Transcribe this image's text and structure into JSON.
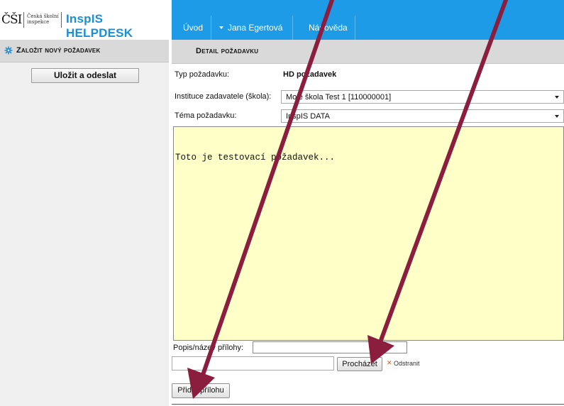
{
  "header": {
    "logo_mark": "ČŠI",
    "logo_org_line1": "Česká školní",
    "logo_org_line2": "inspekce",
    "brand": "InspIS HELPDESK",
    "nav": [
      {
        "label": "Úvod"
      },
      {
        "label": "Jana Egertová",
        "has_dropdown": true
      },
      {
        "label": "Nápověda"
      }
    ]
  },
  "sidebar": {
    "title": "Založit nový požadavek",
    "icon": "gear-icon",
    "save_button": "Uložit a odeslat"
  },
  "main": {
    "title": "Detail požadavku",
    "fields": {
      "type_label": "Typ požadavku:",
      "type_value": "HD požadavek",
      "institution_label": "Instituce zadavatele (škola):",
      "institution_value": "Moje škola Test 1 [110000001]",
      "topic_label": "Téma požadavku:",
      "topic_value": "InspIS DATA"
    },
    "message_text": "Toto je testovací požadavek...",
    "attachment": {
      "label": "Popis/název přílohy:",
      "description_value": "",
      "browse_button": "Procházet",
      "remove_label": "Odstranit",
      "add_button": "Přidat přílohu"
    }
  },
  "colors": {
    "nav_bg": "#1e9be6",
    "brand": "#1b8fd3",
    "textarea_bg": "#ffffc8",
    "annotation_arrow": "#8b1e3f",
    "remove_icon": "#d9531e"
  }
}
